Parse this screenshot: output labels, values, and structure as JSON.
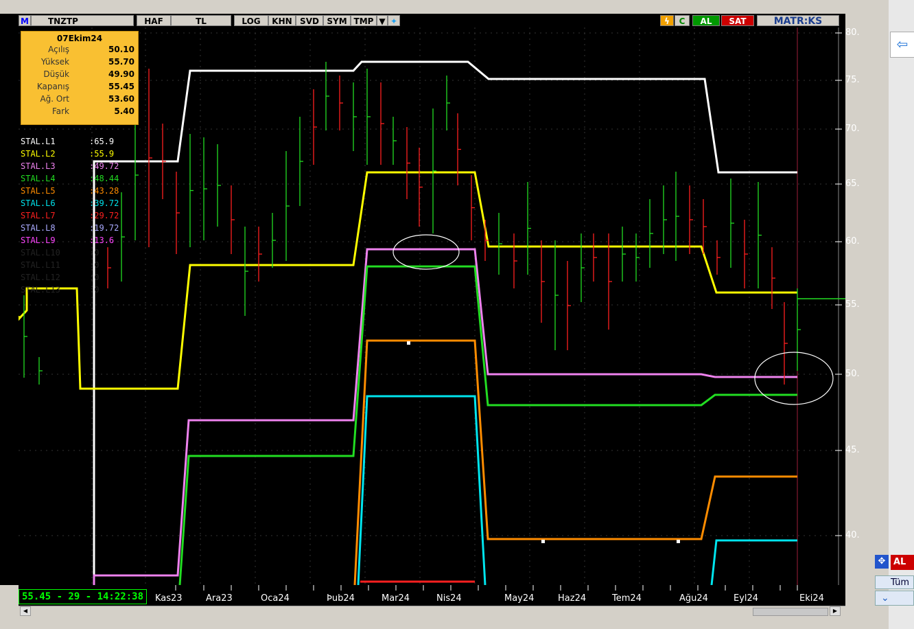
{
  "toolbar": {
    "logo": "M",
    "symbol": "TNZTP",
    "buttons": [
      "HAF",
      "TL",
      "LOG",
      "KHN",
      "SVD",
      "SYM",
      "TMP"
    ],
    "c_label": "C",
    "al_label": "AL",
    "sat_label": "SAT",
    "brand": "MATR:KS"
  },
  "ohlc": {
    "date": "07Ekim24",
    "rows": [
      {
        "label": "Açılış",
        "value": "50.10"
      },
      {
        "label": "Yüksek",
        "value": "55.70"
      },
      {
        "label": "Düşük",
        "value": "49.90"
      },
      {
        "label": "Kapanış",
        "value": "55.45"
      },
      {
        "label": "Ağ. Ort",
        "value": "53.60"
      },
      {
        "label": "Fark",
        "value": "5.40"
      }
    ]
  },
  "legend": [
    {
      "name": "STAL.L1",
      "value": ":65.9",
      "color": "#ffffff"
    },
    {
      "name": "STAL.L2",
      "value": ":55.9",
      "color": "#ffff00"
    },
    {
      "name": "STAL.L3",
      "value": ":49.72",
      "color": "#ee82ee"
    },
    {
      "name": "STAL.L4",
      "value": ":48.44",
      "color": "#22dd22"
    },
    {
      "name": "STAL.L5",
      "value": ":43.28",
      "color": "#ff8c00"
    },
    {
      "name": "STAL.L6",
      "value": ":39.72",
      "color": "#00e5ee"
    },
    {
      "name": "STAL.L7",
      "value": ":29.72",
      "color": "#ff2020"
    },
    {
      "name": "STAL.L8",
      "value": ":19.72",
      "color": "#aaaaff"
    },
    {
      "name": "STAL.L9",
      "value": ":13.6",
      "color": "#ff44ff"
    },
    {
      "name": "STAL.L10",
      "value": ":0",
      "color": "#222222"
    },
    {
      "name": "STAL.L11",
      "value": ":0",
      "color": "#222222"
    },
    {
      "name": "STAL.L12",
      "value": ":0",
      "color": "#222222"
    },
    {
      "name": "STAL.L13",
      "value": ":0",
      "color": "#222222"
    }
  ],
  "status_text": "55.45 - 29 - 14:22:38",
  "x_labels": [
    "Kas23",
    "Ara23",
    "Oca24",
    "Þub24",
    "Mar24",
    "Nis24",
    "May24",
    "Haz24",
    "Tem24",
    "Ağu24",
    "Eyl24",
    "Eki24"
  ],
  "y_labels": [
    "80.",
    "75.",
    "70.",
    "65.",
    "60.",
    "55.",
    "50.",
    "45.",
    "40."
  ],
  "right_panel": {
    "al_label": "AL",
    "tum_label": "Tüm"
  }
}
